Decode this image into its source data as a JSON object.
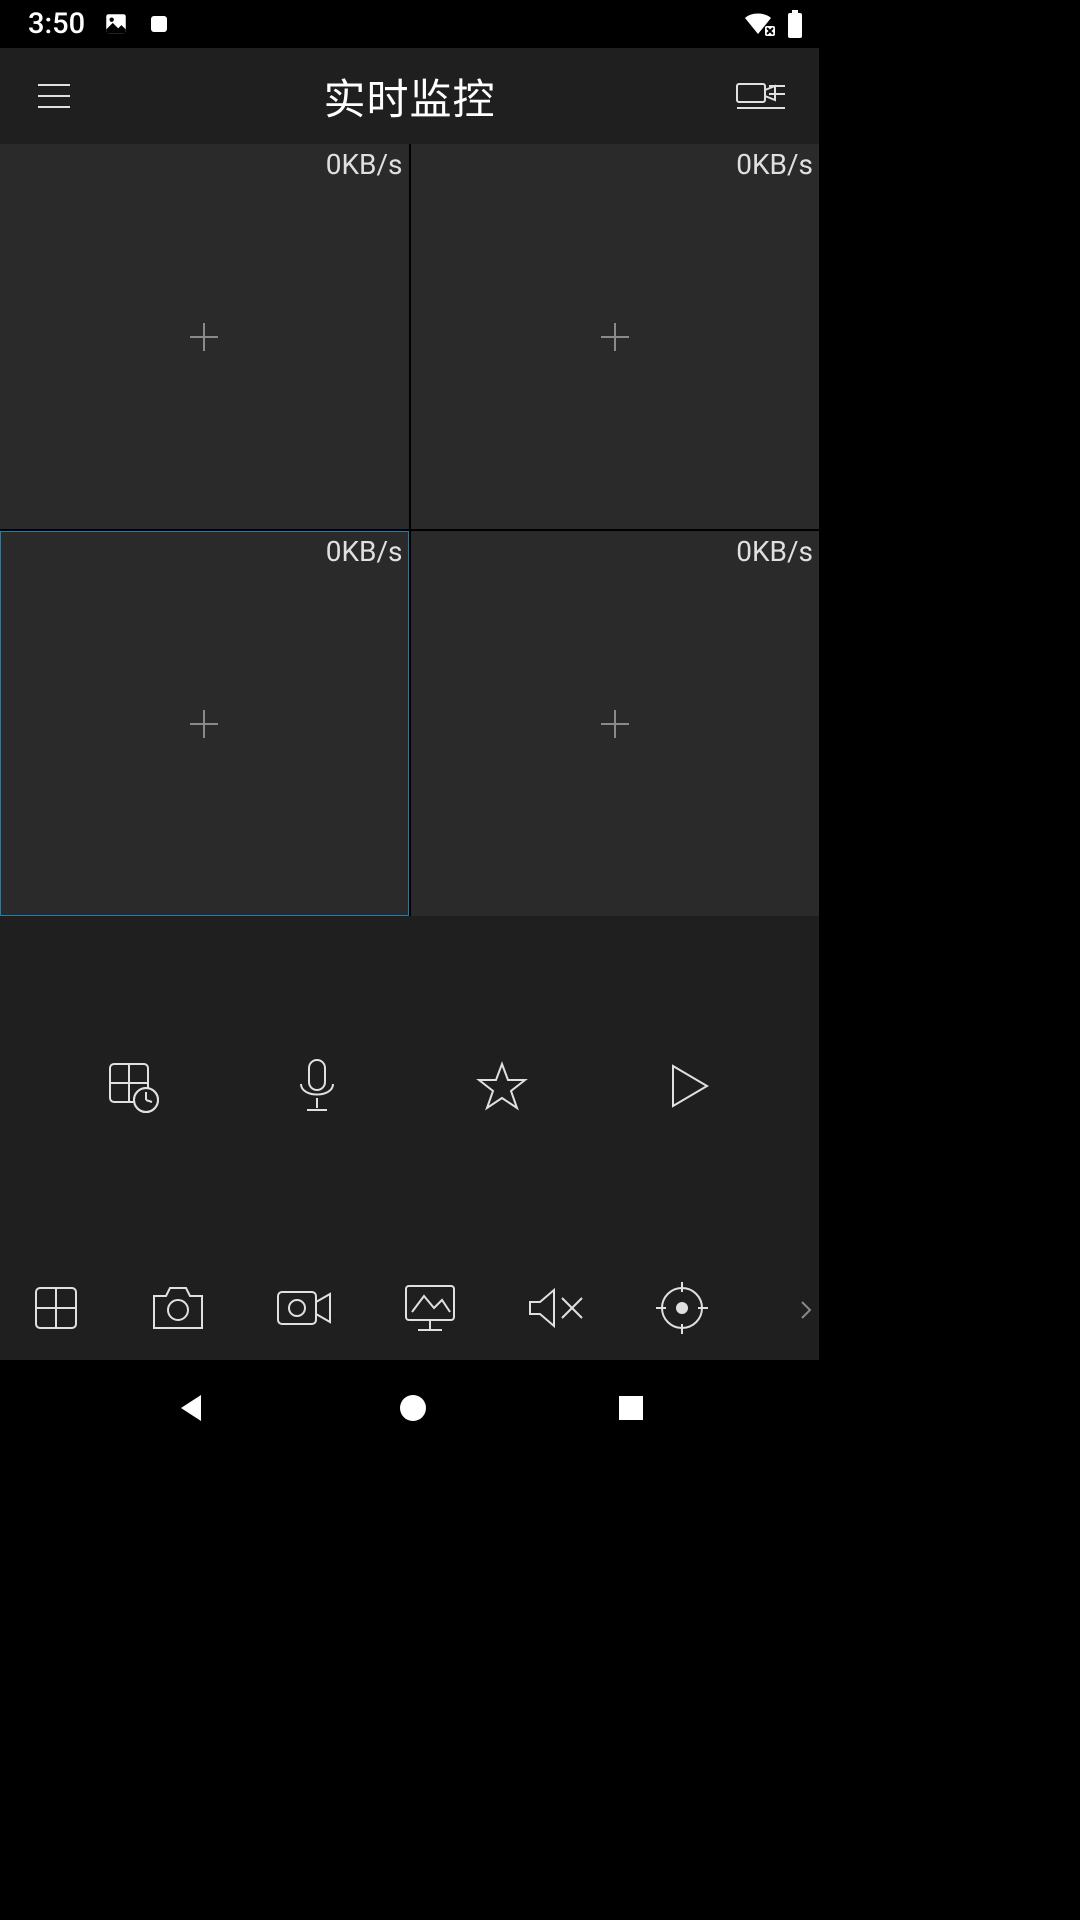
{
  "status": {
    "time": "3:50"
  },
  "header": {
    "title": "实时监控"
  },
  "slots": [
    {
      "rate": "0KB/s"
    },
    {
      "rate": "0KB/s"
    },
    {
      "rate": "0KB/s"
    },
    {
      "rate": "0KB/s"
    }
  ],
  "icons": {
    "menu": "menu",
    "camera_list": "camera-list",
    "grid_clock": "grid-clock",
    "mic": "microphone",
    "star": "star",
    "play": "play",
    "grid": "grid-layout",
    "camera": "camera-shot",
    "video": "video-record",
    "stream": "screen-stream",
    "mute": "mute",
    "target": "target",
    "more": "chevron-right",
    "back": "nav-back",
    "home": "nav-home",
    "recent": "nav-recent"
  },
  "colors": {
    "bg": "#000000",
    "panel": "#1f1f1f",
    "slot": "#2a2a2a",
    "select": "#1c7fad",
    "stroke": "#e0e0e0"
  }
}
